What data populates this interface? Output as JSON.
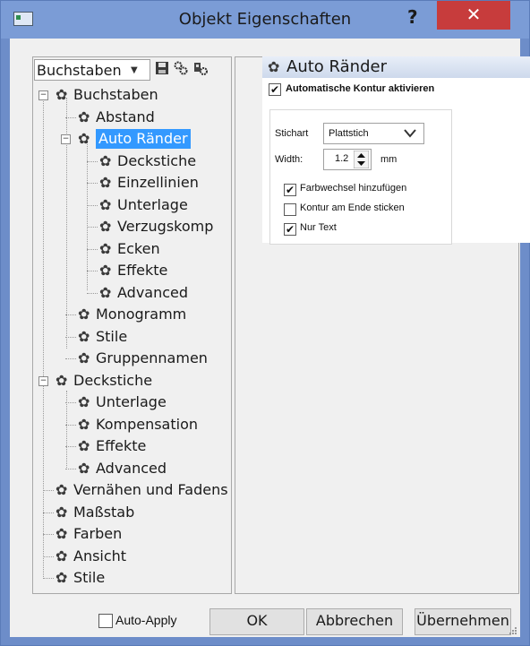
{
  "window": {
    "title": "Objekt Eigenschaften",
    "help_label": "?",
    "close_label": "✕"
  },
  "left_panel": {
    "combo_value": "Buchstaben",
    "tree": [
      {
        "label": "Buchstaben",
        "level": 0,
        "expander": "−"
      },
      {
        "label": "Abstand",
        "level": 1
      },
      {
        "label": "Auto Ränder",
        "level": 1,
        "expander": "−",
        "selected": true
      },
      {
        "label": "Deckstiche",
        "level": 2
      },
      {
        "label": "Einzellinien",
        "level": 2
      },
      {
        "label": "Unterlage",
        "level": 2
      },
      {
        "label": "Verzugskomp",
        "level": 2
      },
      {
        "label": "Ecken",
        "level": 2
      },
      {
        "label": "Effekte",
        "level": 2
      },
      {
        "label": "Advanced",
        "level": 2
      },
      {
        "label": "Monogramm",
        "level": 1
      },
      {
        "label": "Stile",
        "level": 1
      },
      {
        "label": "Gruppennamen",
        "level": 1
      },
      {
        "label": "Deckstiche",
        "level": 0,
        "expander": "−"
      },
      {
        "label": "Unterlage",
        "level": 1
      },
      {
        "label": "Kompensation",
        "level": 1
      },
      {
        "label": "Effekte",
        "level": 1
      },
      {
        "label": "Advanced",
        "level": 1
      },
      {
        "label": "Vernähen und Fadens",
        "level": 0
      },
      {
        "label": "Maßstab",
        "level": 0
      },
      {
        "label": "Farben",
        "level": 0
      },
      {
        "label": "Ansicht",
        "level": 0
      },
      {
        "label": "Stile",
        "level": 0
      }
    ]
  },
  "right_panel": {
    "header": "Auto Ränder",
    "auto_contour_label": "Automatische Kontur aktivieren",
    "auto_contour_checked": true,
    "stitch_type_label": "Stichart",
    "stitch_type_value": "Plattstich",
    "width_label": "Width:",
    "width_value": "1.2",
    "width_unit": "mm",
    "options": [
      {
        "label": "Farbwechsel hinzufügen",
        "checked": true
      },
      {
        "label": "Kontur am Ende sticken",
        "checked": false
      },
      {
        "label": "Nur Text",
        "checked": true
      }
    ]
  },
  "footer": {
    "auto_apply_label": "Auto-Apply",
    "auto_apply_checked": false,
    "ok_label": "OK",
    "cancel_label": "Abbrechen",
    "apply_label": "Übernehmen"
  },
  "icons": [
    "app-icon",
    "help-icon",
    "close-icon",
    "save-icon",
    "gear-group-icon",
    "tree-settings-icon",
    "gear-icon",
    "checkmark-icon",
    "spin-up-icon",
    "spin-down-icon",
    "dropdown-arrow-icon",
    "resize-grip-icon"
  ],
  "colors": {
    "titlebar": "#7b9cd6",
    "close": "#c73c3c",
    "selection": "#3399ff",
    "panel": "#f0f0f0"
  }
}
